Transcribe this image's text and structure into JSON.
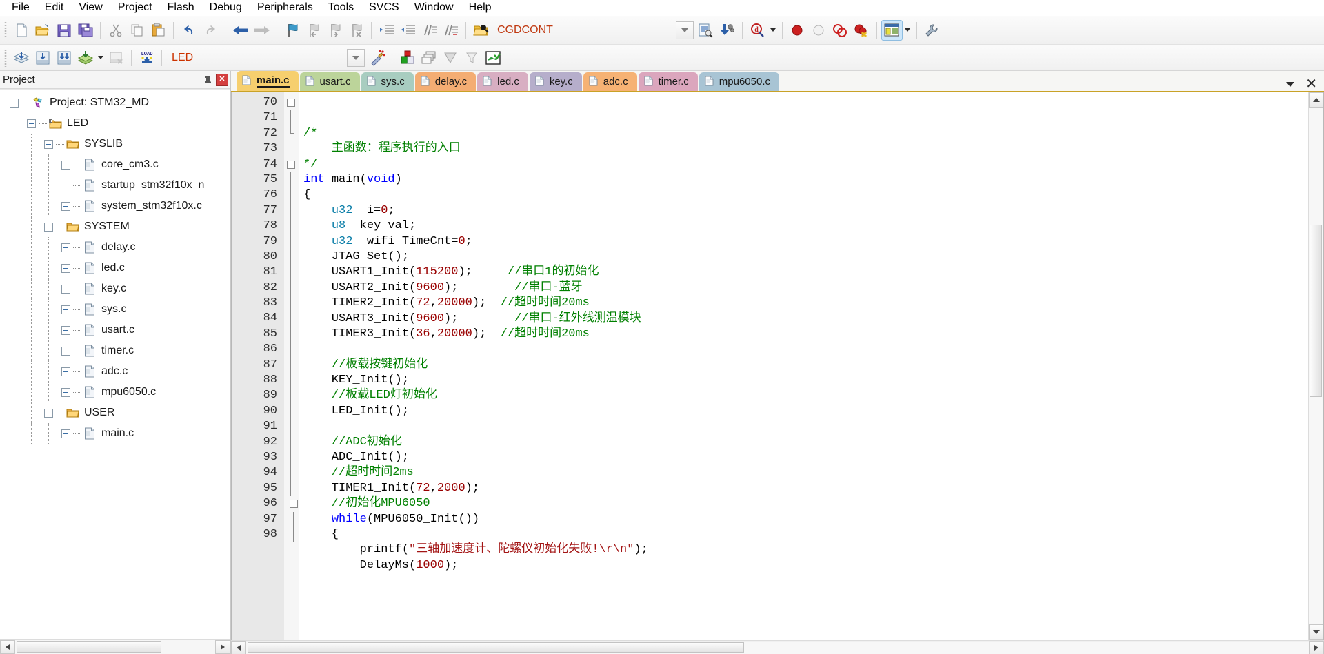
{
  "menu": {
    "items": [
      "File",
      "Edit",
      "View",
      "Project",
      "Flash",
      "Debug",
      "Peripherals",
      "Tools",
      "SVCS",
      "Window",
      "Help"
    ]
  },
  "toolbar_main": {
    "icons": [
      "new-file-icon",
      "open-file-icon",
      "save-icon",
      "save-all-icon",
      "cut-icon",
      "copy-icon",
      "paste-icon",
      "undo-icon",
      "redo-icon",
      "navigate-back-icon",
      "navigate-forward-icon",
      "bookmark-toggle-icon",
      "bookmark-prev-icon",
      "bookmark-next-icon",
      "bookmark-clear-icon",
      "indent-right-icon",
      "indent-left-icon",
      "comment-block-icon",
      "uncomment-block-icon",
      "find-in-files-icon"
    ],
    "search_value": "CGDCONT",
    "combo_arrow": "chevron-down-icon",
    "incremental_find_icon": "incremental-find-icon",
    "bookmark_goto_icon": "goto-definition-icon",
    "magnify_icon": "find-icon",
    "breakpoint_icons": [
      "insert-breakpoint-icon",
      "disable-breakpoint-icon",
      "disable-all-breakpoints-icon",
      "kill-all-breakpoints-icon"
    ],
    "window_layout_icon": "project-window-icon",
    "configure_icon": "configure-target-options-icon"
  },
  "toolbar_build": {
    "icons": [
      "translate-icon",
      "build-target-icon",
      "rebuild-all-icon",
      "batch-build-icon",
      "stop-build-icon",
      "download-icon"
    ],
    "target_value": "LED",
    "target_arrow": "chevron-down-icon",
    "wizard_icon": "start-debug-session-icon",
    "manage_icons": [
      "manage-project-items-icon",
      "manage-multi-project-icon",
      "pack-installer-icon",
      "filter-icon",
      "manage-runtime-env-icon"
    ]
  },
  "project_panel": {
    "title": "Project",
    "pin_icon": "pin-icon",
    "close_icon": "close-icon",
    "tree": [
      {
        "label": "Project: STM32_MD",
        "depth": 0,
        "icon": "project-icon",
        "expander": "minus"
      },
      {
        "label": "LED",
        "depth": 1,
        "icon": "target-icon",
        "expander": "minus"
      },
      {
        "label": "SYSLIB",
        "depth": 2,
        "icon": "folder-icon",
        "expander": "minus"
      },
      {
        "label": "core_cm3.c",
        "depth": 3,
        "icon": "c-file-icon",
        "expander": "plus"
      },
      {
        "label": "startup_stm32f10x_n",
        "depth": 3,
        "icon": "c-file-icon",
        "expander": "none"
      },
      {
        "label": "system_stm32f10x.c",
        "depth": 3,
        "icon": "c-file-icon",
        "expander": "plus"
      },
      {
        "label": "SYSTEM",
        "depth": 2,
        "icon": "folder-icon",
        "expander": "minus"
      },
      {
        "label": "delay.c",
        "depth": 3,
        "icon": "c-file-icon",
        "expander": "plus"
      },
      {
        "label": "led.c",
        "depth": 3,
        "icon": "c-file-icon",
        "expander": "plus"
      },
      {
        "label": "key.c",
        "depth": 3,
        "icon": "c-file-icon",
        "expander": "plus"
      },
      {
        "label": "sys.c",
        "depth": 3,
        "icon": "c-file-icon",
        "expander": "plus"
      },
      {
        "label": "usart.c",
        "depth": 3,
        "icon": "c-file-icon",
        "expander": "plus"
      },
      {
        "label": "timer.c",
        "depth": 3,
        "icon": "c-file-icon",
        "expander": "plus"
      },
      {
        "label": "adc.c",
        "depth": 3,
        "icon": "c-file-icon",
        "expander": "plus"
      },
      {
        "label": "mpu6050.c",
        "depth": 3,
        "icon": "c-file-icon",
        "expander": "plus"
      },
      {
        "label": "USER",
        "depth": 2,
        "icon": "folder-icon",
        "expander": "minus"
      },
      {
        "label": "main.c",
        "depth": 3,
        "icon": "c-file-icon",
        "expander": "plus"
      }
    ]
  },
  "editor": {
    "tabs": [
      {
        "label": "main.c",
        "color": "#f6cf6e",
        "active": true
      },
      {
        "label": "usart.c",
        "color": "#bcd49a",
        "active": false
      },
      {
        "label": "sys.c",
        "color": "#a8cdc0",
        "active": false
      },
      {
        "label": "delay.c",
        "color": "#f4ad73",
        "active": false
      },
      {
        "label": "led.c",
        "color": "#d8aec2",
        "active": false
      },
      {
        "label": "key.c",
        "color": "#b6aecb",
        "active": false
      },
      {
        "label": "adc.c",
        "color": "#f6b274",
        "active": false
      },
      {
        "label": "timer.c",
        "color": "#dba6bd",
        "active": false
      },
      {
        "label": "mpu6050.c",
        "color": "#a8c4d4",
        "active": false
      }
    ],
    "tab_overflow_icon": "chevron-down-icon",
    "tab_close_icon": "close-icon",
    "first_line_number": 70,
    "lines": [
      {
        "n": 70,
        "fold": "start",
        "tokens": [
          {
            "t": "/*",
            "c": "cm"
          }
        ]
      },
      {
        "n": 71,
        "fold": "bar",
        "tokens": [
          {
            "t": "    主函数：程序执行的入口",
            "c": "cm"
          }
        ]
      },
      {
        "n": 72,
        "fold": "end",
        "tokens": [
          {
            "t": "*/",
            "c": "cm"
          }
        ]
      },
      {
        "n": 73,
        "fold": "none",
        "tokens": [
          {
            "t": "int ",
            "c": "kw"
          },
          {
            "t": "main(",
            "c": "fn"
          },
          {
            "t": "void",
            "c": "kw"
          },
          {
            "t": ")",
            "c": "fn"
          }
        ]
      },
      {
        "n": 74,
        "fold": "start",
        "tokens": [
          {
            "t": "{",
            "c": "fn"
          }
        ]
      },
      {
        "n": 75,
        "fold": "bar",
        "tokens": [
          {
            "t": "    ",
            "c": "fn"
          },
          {
            "t": "u32",
            "c": "typ"
          },
          {
            "t": "  i=",
            "c": "fn"
          },
          {
            "t": "0",
            "c": "num"
          },
          {
            "t": ";",
            "c": "fn"
          }
        ]
      },
      {
        "n": 76,
        "fold": "bar",
        "tokens": [
          {
            "t": "    ",
            "c": "fn"
          },
          {
            "t": "u8",
            "c": "typ"
          },
          {
            "t": "  key_val;",
            "c": "fn"
          }
        ]
      },
      {
        "n": 77,
        "fold": "bar",
        "tokens": [
          {
            "t": "    ",
            "c": "fn"
          },
          {
            "t": "u32",
            "c": "typ"
          },
          {
            "t": "  wifi_TimeCnt=",
            "c": "fn"
          },
          {
            "t": "0",
            "c": "num"
          },
          {
            "t": ";",
            "c": "fn"
          }
        ]
      },
      {
        "n": 78,
        "fold": "bar",
        "tokens": [
          {
            "t": "    JTAG_Set();",
            "c": "fn"
          }
        ]
      },
      {
        "n": 79,
        "fold": "bar",
        "tokens": [
          {
            "t": "    USART1_Init(",
            "c": "fn"
          },
          {
            "t": "115200",
            "c": "num"
          },
          {
            "t": ");     ",
            "c": "fn"
          },
          {
            "t": "//串口1的初始化",
            "c": "cm"
          }
        ]
      },
      {
        "n": 80,
        "fold": "bar",
        "tokens": [
          {
            "t": "    USART2_Init(",
            "c": "fn"
          },
          {
            "t": "9600",
            "c": "num"
          },
          {
            "t": ");        ",
            "c": "fn"
          },
          {
            "t": "//串口-蓝牙",
            "c": "cm"
          }
        ]
      },
      {
        "n": 81,
        "fold": "bar",
        "tokens": [
          {
            "t": "    TIMER2_Init(",
            "c": "fn"
          },
          {
            "t": "72",
            "c": "num"
          },
          {
            "t": ",",
            "c": "fn"
          },
          {
            "t": "20000",
            "c": "num"
          },
          {
            "t": ");  ",
            "c": "fn"
          },
          {
            "t": "//超时时间20ms",
            "c": "cm"
          }
        ]
      },
      {
        "n": 82,
        "fold": "bar",
        "tokens": [
          {
            "t": "    USART3_Init(",
            "c": "fn"
          },
          {
            "t": "9600",
            "c": "num"
          },
          {
            "t": ");        ",
            "c": "fn"
          },
          {
            "t": "//串口-红外线测温模块",
            "c": "cm"
          }
        ]
      },
      {
        "n": 83,
        "fold": "bar",
        "tokens": [
          {
            "t": "    TIMER3_Init(",
            "c": "fn"
          },
          {
            "t": "36",
            "c": "num"
          },
          {
            "t": ",",
            "c": "fn"
          },
          {
            "t": "20000",
            "c": "num"
          },
          {
            "t": ");  ",
            "c": "fn"
          },
          {
            "t": "//超时时间20ms",
            "c": "cm"
          }
        ]
      },
      {
        "n": 84,
        "fold": "bar",
        "tokens": []
      },
      {
        "n": 85,
        "fold": "bar",
        "tokens": [
          {
            "t": "    //板载按键初始化",
            "c": "cm"
          }
        ]
      },
      {
        "n": 86,
        "fold": "bar",
        "tokens": [
          {
            "t": "    KEY_Init();",
            "c": "fn"
          }
        ]
      },
      {
        "n": 87,
        "fold": "bar",
        "tokens": [
          {
            "t": "    //板载LED灯初始化",
            "c": "cm"
          }
        ]
      },
      {
        "n": 88,
        "fold": "bar",
        "tokens": [
          {
            "t": "    LED_Init();",
            "c": "fn"
          }
        ]
      },
      {
        "n": 89,
        "fold": "bar",
        "tokens": []
      },
      {
        "n": 90,
        "fold": "bar",
        "tokens": [
          {
            "t": "    //ADC初始化",
            "c": "cm"
          }
        ]
      },
      {
        "n": 91,
        "fold": "bar",
        "tokens": [
          {
            "t": "    ADC_Init();",
            "c": "fn"
          }
        ]
      },
      {
        "n": 92,
        "fold": "bar",
        "tokens": [
          {
            "t": "    //超时时间2ms",
            "c": "cm"
          }
        ]
      },
      {
        "n": 93,
        "fold": "bar",
        "tokens": [
          {
            "t": "    TIMER1_Init(",
            "c": "fn"
          },
          {
            "t": "72",
            "c": "num"
          },
          {
            "t": ",",
            "c": "fn"
          },
          {
            "t": "2000",
            "c": "num"
          },
          {
            "t": ");",
            "c": "fn"
          }
        ]
      },
      {
        "n": 94,
        "fold": "bar",
        "tokens": [
          {
            "t": "    //初始化MPU6050",
            "c": "cm"
          }
        ]
      },
      {
        "n": 95,
        "fold": "bar",
        "tokens": [
          {
            "t": "    ",
            "c": "fn"
          },
          {
            "t": "while",
            "c": "kw"
          },
          {
            "t": "(MPU6050_Init())",
            "c": "fn"
          }
        ]
      },
      {
        "n": 96,
        "fold": "start2",
        "tokens": [
          {
            "t": "    {",
            "c": "fn"
          }
        ]
      },
      {
        "n": 97,
        "fold": "bar2",
        "tokens": [
          {
            "t": "        printf(",
            "c": "fn"
          },
          {
            "t": "\"三轴加速度计、陀螺仪初始化失败!\\r\\n\"",
            "c": "str"
          },
          {
            "t": ");",
            "c": "fn"
          }
        ]
      },
      {
        "n": 98,
        "fold": "bar2",
        "tokens": [
          {
            "t": "        DelayMs(",
            "c": "fn"
          },
          {
            "t": "1000",
            "c": "num"
          },
          {
            "t": ");",
            "c": "fn"
          }
        ]
      }
    ]
  }
}
